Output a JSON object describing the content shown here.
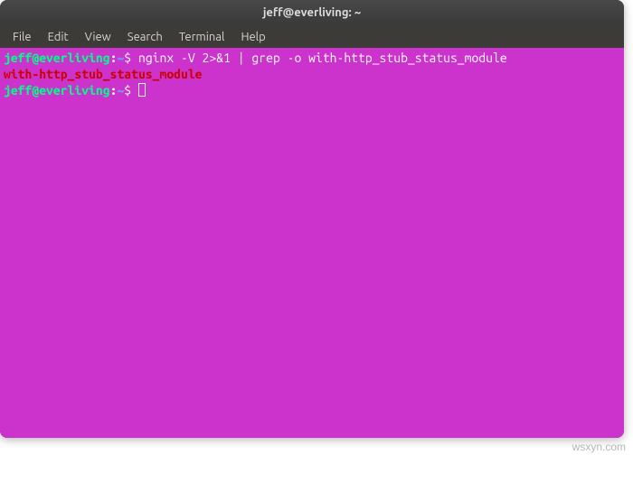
{
  "window": {
    "title": "jeff@everliving: ~"
  },
  "menubar": {
    "items": [
      "File",
      "Edit",
      "View",
      "Search",
      "Terminal",
      "Help"
    ]
  },
  "terminal": {
    "lines": [
      {
        "prompt_user": "jeff@everliving",
        "prompt_sep": ":",
        "prompt_path": "~",
        "prompt_dollar": "$ ",
        "command": "nginx -V 2>&1 | grep -o with-http_stub_status_module"
      },
      {
        "output": "with-http_stub_status_module"
      },
      {
        "prompt_user": "jeff@everliving",
        "prompt_sep": ":",
        "prompt_path": "~",
        "prompt_dollar": "$ ",
        "command": ""
      }
    ]
  },
  "watermark": "wsxyn.com"
}
